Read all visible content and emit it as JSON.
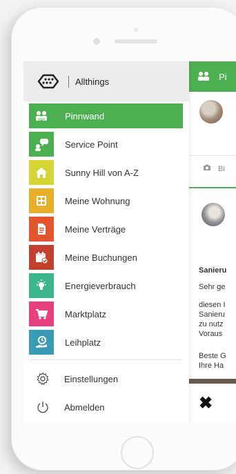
{
  "header": {
    "app_name": "Allthings"
  },
  "menu": {
    "items": [
      {
        "label": "Pinnwand",
        "icon": "pinboard-icon",
        "color": "#4caf50",
        "active": true
      },
      {
        "label": "Service Point",
        "icon": "chat-icon",
        "color": "#4caf50"
      },
      {
        "label": "Sunny Hill von A-Z",
        "icon": "home-icon",
        "color": "#d4d636"
      },
      {
        "label": "Meine Wohnung",
        "icon": "apartment-icon",
        "color": "#e8b02a"
      },
      {
        "label": "Meine Verträge",
        "icon": "document-icon",
        "color": "#e2552d"
      },
      {
        "label": "Meine Buchungen",
        "icon": "calendar-icon",
        "color": "#c2412e"
      },
      {
        "label": "Energieverbrauch",
        "icon": "bulb-icon",
        "color": "#3db58d"
      },
      {
        "label": "Marktplatz",
        "icon": "cart-icon",
        "color": "#e8407e"
      },
      {
        "label": "Leihplatz",
        "icon": "lend-icon",
        "color": "#3a9bb5"
      }
    ],
    "settings_label": "Einstellungen",
    "logout_label": "Abmelden"
  },
  "background_app": {
    "header_label": "Pi",
    "tab_label": "Bi",
    "post_title": "Sanieru",
    "post_lines": [
      "Sehr ge",
      "diesen I",
      "Sanieru",
      "zu nutz",
      "Voraus",
      "Beste G",
      "Ihre Ha"
    ]
  }
}
